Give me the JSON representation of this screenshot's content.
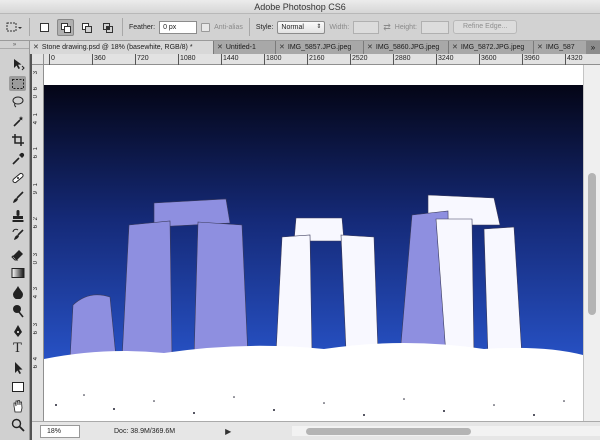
{
  "window": {
    "title": "Adobe Photoshop CS6"
  },
  "options_bar": {
    "feather_label": "Feather:",
    "feather_value": "0 px",
    "antialias_label": "Anti-alias",
    "style_label": "Style:",
    "style_value": "Normal",
    "width_label": "Width:",
    "height_label": "Height:",
    "refine_edge_label": "Refine Edge..."
  },
  "tabs": [
    {
      "label": "Stone drawing.psd @ 18% (basewhite, RGB/8) *",
      "active": true
    },
    {
      "label": "Untitled-1",
      "active": false
    },
    {
      "label": "IMG_5857.JPG.jpeg",
      "active": false
    },
    {
      "label": "IMG_5860.JPG.jpeg",
      "active": false
    },
    {
      "label": "IMG_5872.JPG.jpeg",
      "active": false
    },
    {
      "label": "IMG_587",
      "active": false
    }
  ],
  "tabs_overflow_icon": "double-chevron-right-icon",
  "ruler": {
    "horizontal": [
      "0",
      "360",
      "720",
      "1080",
      "1440",
      "1800",
      "2160",
      "2520",
      "2880",
      "3240",
      "3600",
      "3960",
      "4320"
    ],
    "vertical": [
      "3",
      "6",
      "0",
      "1",
      "4",
      "1",
      "6",
      "1",
      "9",
      "2",
      "6",
      "3",
      "0",
      "3",
      "4",
      "3",
      "6",
      "4",
      "6"
    ]
  },
  "status": {
    "zoom": "18%",
    "doc": "Doc: 38.9M/369.6M"
  },
  "colors": {
    "sky_top": "#040516",
    "sky_bottom": "#2552c8",
    "stone": "#8e8fe0",
    "ground": "#ffffff"
  },
  "tools": [
    "move-icon",
    "marquee-icon",
    "lasso-icon",
    "quick-select-icon",
    "crop-icon",
    "eyedropper-icon",
    "healing-icon",
    "brush-icon",
    "stamp-icon",
    "history-brush-icon",
    "eraser-icon",
    "gradient-icon",
    "blur-icon",
    "dodge-icon",
    "pen-icon",
    "type-icon",
    "path-select-icon",
    "shape-icon",
    "hand-icon",
    "zoom-icon"
  ]
}
